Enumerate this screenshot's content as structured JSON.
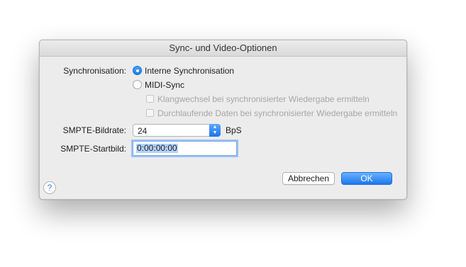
{
  "dialog": {
    "title": "Sync- und Video-Optionen"
  },
  "sync": {
    "label": "Synchronisation:",
    "option_internal": "Interne Synchronisation",
    "option_midi": "MIDI-Sync",
    "selected": "Interne Synchronisation",
    "check_sound": "Klangwechsel bei synchronisierter Wiedergabe ermitteln",
    "check_data": "Durchlaufende Daten bei synchronisierter Wiedergabe ermitteln"
  },
  "smpte": {
    "rate_label": "SMPTE-Bildrate:",
    "rate_value": "24",
    "rate_unit": "BpS",
    "start_label": "SMPTE-Startbild:",
    "start_value": "0:00:00:00"
  },
  "buttons": {
    "cancel": "Abbrechen",
    "ok": "OK",
    "help": "?"
  },
  "colors": {
    "accent": "#1a7cf0",
    "dialog_bg": "#ececec"
  }
}
